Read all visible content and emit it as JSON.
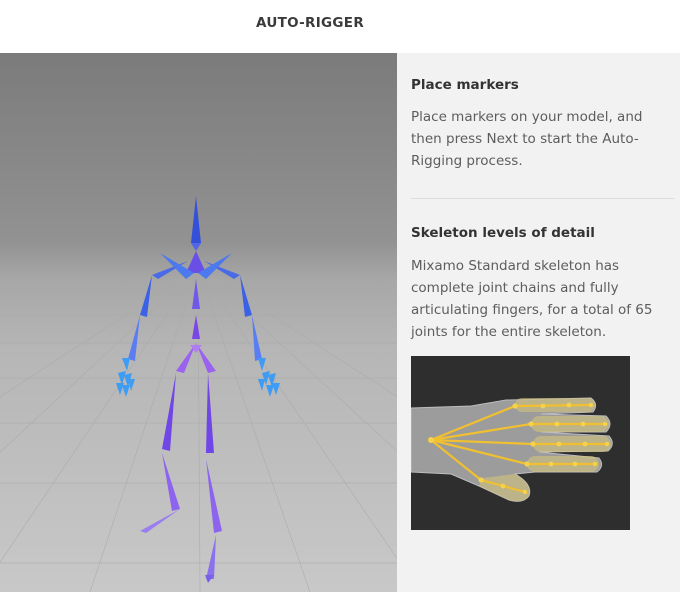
{
  "header": {
    "title": "AUTO-RIGGER"
  },
  "panel": {
    "sections": [
      {
        "title": "Place markers",
        "text": "Place markers on your model, and then press Next to start the Auto-Rigging process."
      },
      {
        "title": "Skeleton levels of detail",
        "text": "Mixamo Standard skeleton has complete joint chains and fully articulating fingers, for a total of 65 joints for the entire skeleton."
      }
    ],
    "image": {
      "subject": "skeleton-hand-illustration"
    }
  },
  "colors": {
    "panel_background": "#f2f2f2",
    "viewport_sky": "#8a8a8a",
    "viewport_floor": "#b8b8b8",
    "bone_blue": "#3f63e0",
    "bone_purple": "#7a46e6",
    "bone_violet": "#9d7cf0",
    "hand_bones": "#f0c030"
  }
}
